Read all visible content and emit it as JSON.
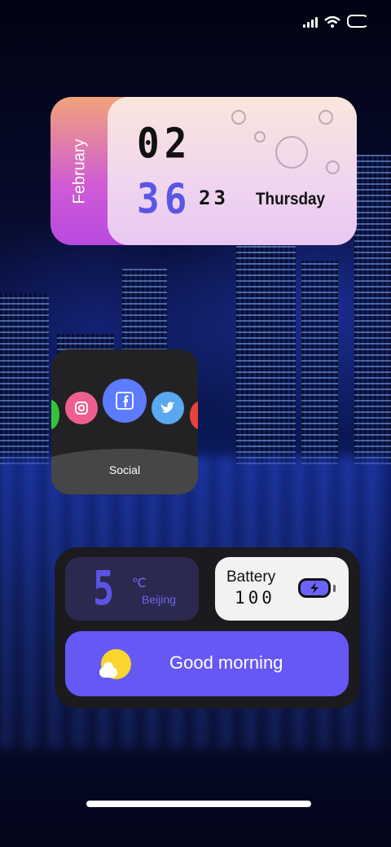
{
  "date_widget": {
    "month": "February",
    "hour": "02",
    "minute": "36",
    "second": "23",
    "weekday": "Thursday"
  },
  "social_widget": {
    "label": "Social",
    "apps": [
      "instagram-icon",
      "facebook-icon",
      "twitter-icon"
    ]
  },
  "weather_widget": {
    "temperature": "5",
    "unit": "℃",
    "city": "Beijing"
  },
  "battery_widget": {
    "label": "Battery",
    "value": "100"
  },
  "greeting_widget": {
    "text": "Good morning",
    "icon": "sun-cloud-icon"
  },
  "colors": {
    "accent": "#6658f4",
    "date_gradient_top": "#f2a37a",
    "date_gradient_bottom": "#b84ae0",
    "weather_bg": "#2b2950",
    "sun": "#f9d52d"
  }
}
